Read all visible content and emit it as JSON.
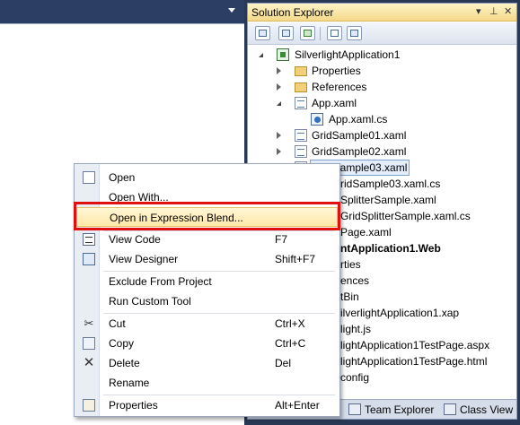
{
  "solution_explorer": {
    "title": "Solution Explorer",
    "title_controls": [
      "▾",
      "⊥",
      "✕"
    ],
    "toolbar_icons": [
      "properties-icon",
      "show-all-files-icon",
      "refresh-icon",
      "view-code-icon",
      "view-designer-icon"
    ],
    "tree": [
      {
        "label": "SilverlightApplication1",
        "icon": "silverlight-project-icon",
        "expander": "expanded"
      },
      {
        "label": "Properties",
        "icon": "properties-folder-icon",
        "expander": "collapsed"
      },
      {
        "label": "References",
        "icon": "references-folder-icon",
        "expander": "collapsed"
      },
      {
        "label": "App.xaml",
        "icon": "xaml-file-icon",
        "expander": "expanded"
      },
      {
        "label": "App.xaml.cs",
        "icon": "csharp-file-icon",
        "expander": "none"
      },
      {
        "label": "GridSample01.xaml",
        "icon": "xaml-file-icon",
        "expander": "collapsed"
      },
      {
        "label": "GridSample02.xaml",
        "icon": "xaml-file-icon",
        "expander": "collapsed"
      },
      {
        "label": "GridSample03.xaml",
        "icon": "xaml-file-icon",
        "expander": "none",
        "selected": true
      },
      {
        "label": "ridSample03.xaml.cs"
      },
      {
        "label": "SplitterSample.xaml"
      },
      {
        "label": "GridSplitterSample.xaml.cs"
      },
      {
        "label": "Page.xaml"
      },
      {
        "label": "ntApplication1.Web",
        "bold": true
      },
      {
        "label": "rties"
      },
      {
        "label": "ences"
      },
      {
        "label": "tBin"
      },
      {
        "label": "ilverlightApplication1.xap"
      },
      {
        "label": "light.js"
      },
      {
        "label": "lightApplication1TestPage.aspx"
      },
      {
        "label": "lightApplication1TestPage.html"
      },
      {
        "label": "config"
      }
    ],
    "bottom_tabs": [
      {
        "label": "Team Explorer",
        "icon": "team-explorer-icon"
      },
      {
        "label": "Class View",
        "icon": "class-view-icon"
      }
    ]
  },
  "context_menu": {
    "items": [
      {
        "label": "Open",
        "shortcut": "",
        "icon": "open-icon"
      },
      {
        "label": "Open With...",
        "shortcut": "",
        "icon": ""
      },
      {
        "label": "Open in Expression Blend...",
        "shortcut": "",
        "icon": "",
        "highlighted": true
      },
      {
        "label": "View Code",
        "shortcut": "F7",
        "icon": "view-code-icon"
      },
      {
        "label": "View Designer",
        "shortcut": "Shift+F7",
        "icon": "view-designer-icon"
      },
      {
        "label": "Exclude From Project",
        "shortcut": "",
        "icon": ""
      },
      {
        "label": "Run Custom Tool",
        "shortcut": "",
        "icon": ""
      },
      {
        "label": "Cut",
        "shortcut": "Ctrl+X",
        "icon": "scissors-icon"
      },
      {
        "label": "Copy",
        "shortcut": "Ctrl+C",
        "icon": "copy-icon"
      },
      {
        "label": "Delete",
        "shortcut": "Del",
        "icon": "delete-icon"
      },
      {
        "label": "Rename",
        "shortcut": "",
        "icon": ""
      },
      {
        "label": "Properties",
        "shortcut": "Alt+Enter",
        "icon": "properties-icon"
      }
    ]
  },
  "colors": {
    "ide_background": "#293955",
    "title_gradient": "#f5d98a",
    "menu_highlight": "#ffe9a8",
    "annotation_box": "#e01010"
  }
}
